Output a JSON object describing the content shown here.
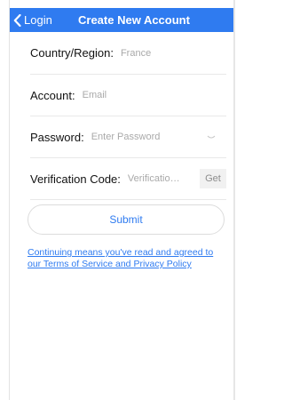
{
  "header": {
    "back_label": "Login",
    "title": "Create New Account",
    "color": "#2f7bf0"
  },
  "form": {
    "country": {
      "label": "Country/Region",
      "colon": ":",
      "value": "France"
    },
    "account": {
      "label": "Account",
      "colon": ":",
      "placeholder": "Email"
    },
    "password": {
      "label": "Password",
      "colon": ":",
      "placeholder": "Enter Password",
      "toggle_icon": "eye-closed-icon"
    },
    "verification": {
      "label": "Verification Code",
      "colon": ":",
      "placeholder": "Verification C...",
      "get_label": "Get"
    }
  },
  "submit_label": "Submit",
  "terms_line1": "Continuing means you've read and agreed to",
  "terms_line2": "our Terms of Service and Privacy Policy"
}
